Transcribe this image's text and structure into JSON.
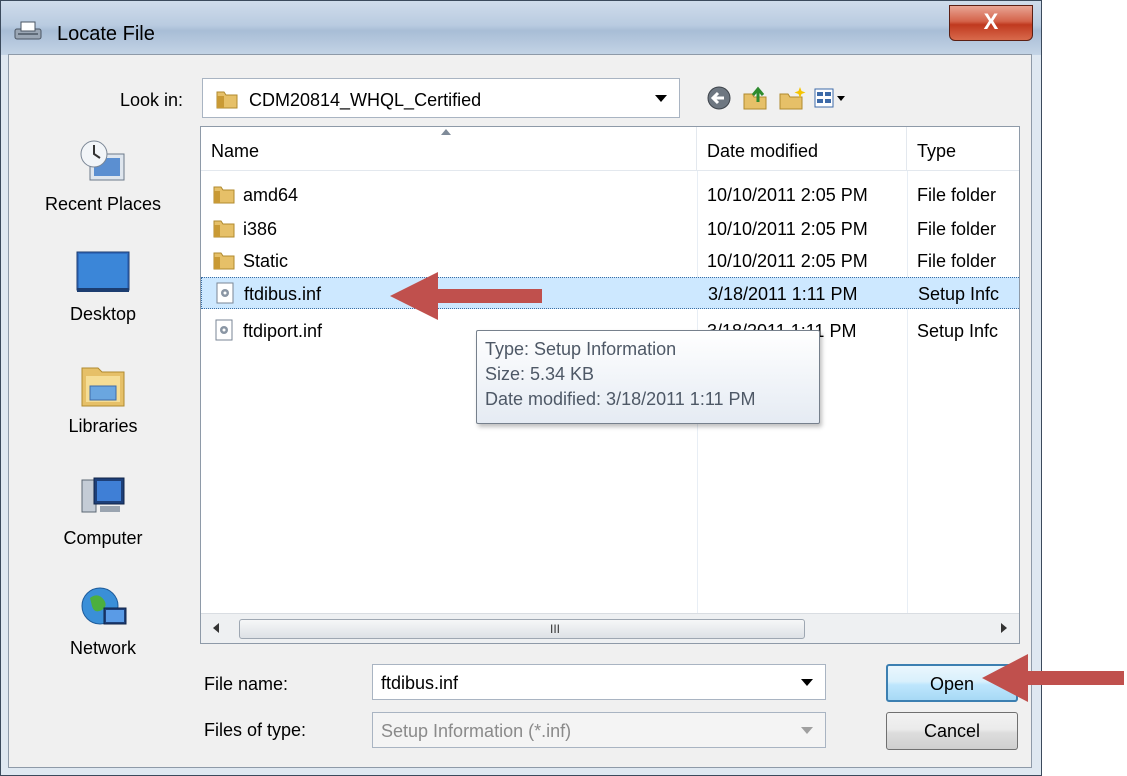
{
  "window": {
    "title": "Locate File",
    "close_label": "X"
  },
  "toolbar": {
    "look_in_label": "Look in:",
    "look_in_value": "CDM20814_WHQL_Certified"
  },
  "places": [
    {
      "label": "Recent Places",
      "icon": "recent-places-icon"
    },
    {
      "label": "Desktop",
      "icon": "desktop-icon"
    },
    {
      "label": "Libraries",
      "icon": "libraries-icon"
    },
    {
      "label": "Computer",
      "icon": "computer-icon"
    },
    {
      "label": "Network",
      "icon": "network-icon"
    }
  ],
  "list": {
    "columns": [
      "Name",
      "Date modified",
      "Type"
    ],
    "rows": [
      {
        "name": "amd64",
        "date": "10/10/2011 2:05 PM",
        "type": "File folder",
        "icon": "folder-icon"
      },
      {
        "name": "i386",
        "date": "10/10/2011 2:05 PM",
        "type": "File folder",
        "icon": "folder-icon"
      },
      {
        "name": "Static",
        "date": "10/10/2011 2:05 PM",
        "type": "File folder",
        "icon": "folder-icon"
      },
      {
        "name": "ftdibus.inf",
        "date": "3/18/2011 1:11 PM",
        "type": "Setup Infc",
        "icon": "setup-file-icon",
        "selected": true
      },
      {
        "name": "ftdiport.inf",
        "date": "3/18/2011 1:11 PM",
        "type": "Setup Infc",
        "icon": "setup-file-icon"
      }
    ],
    "scroll_grip": "III"
  },
  "tooltip": {
    "type": "Type: Setup Information",
    "size": "Size: 5.34 KB",
    "date": "Date modified: 3/18/2011 1:11 PM"
  },
  "form": {
    "file_name_label": "File name:",
    "file_name_value": "ftdibus.inf",
    "file_type_label": "Files of type:",
    "file_type_value": "Setup Information (*.inf)"
  },
  "buttons": {
    "open": "Open",
    "cancel": "Cancel"
  },
  "colors": {
    "annotation_arrow": "#c0504d",
    "selection": "#cde8ff"
  }
}
